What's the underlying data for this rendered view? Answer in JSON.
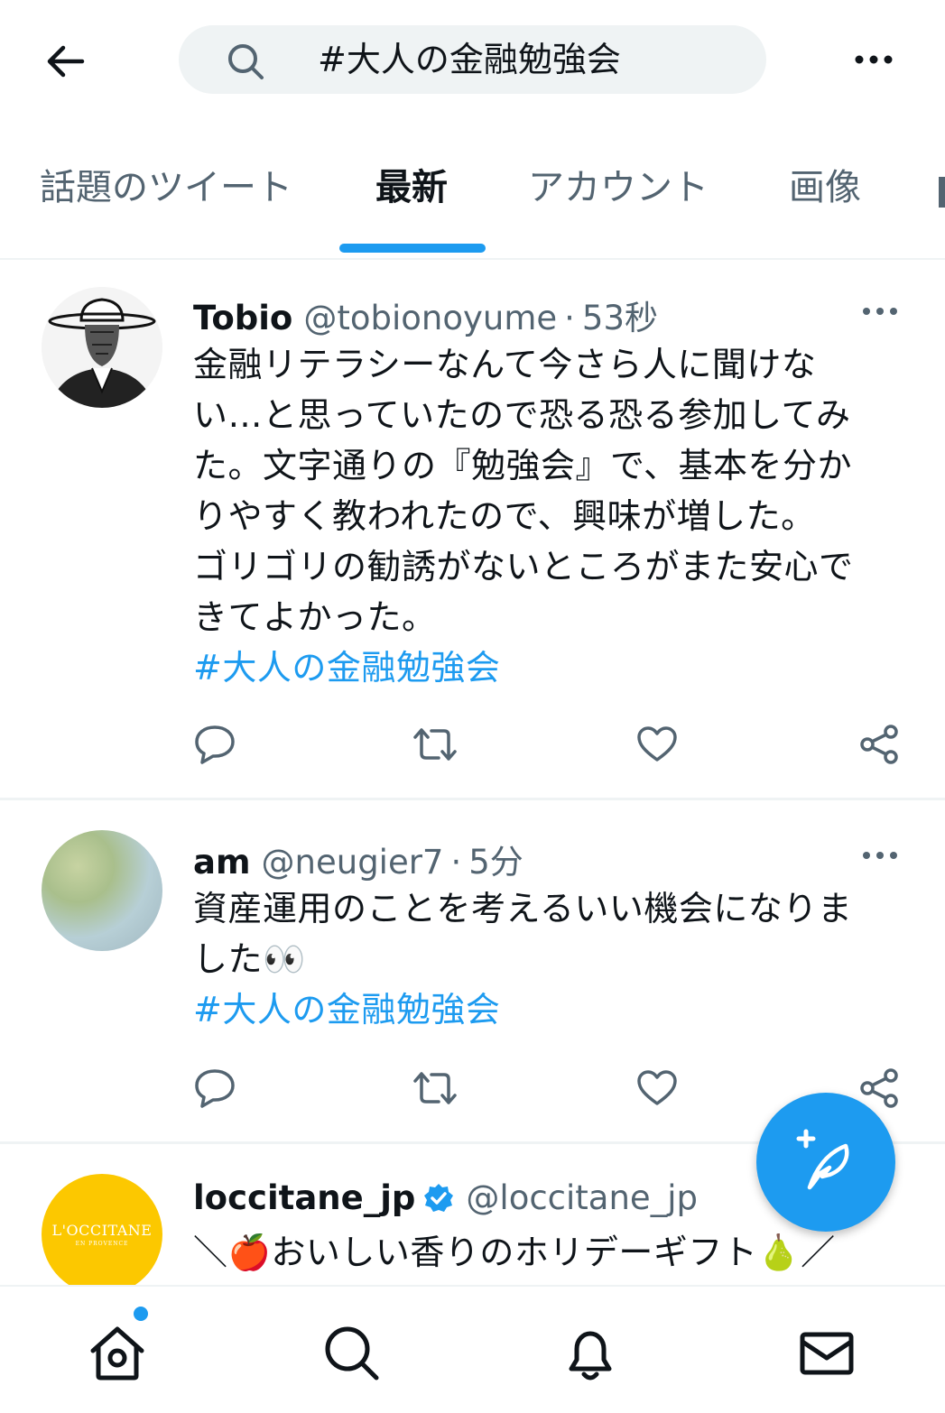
{
  "search": {
    "query": "#大人の金融勉強会"
  },
  "tabs": [
    {
      "label": "話題のツイート"
    },
    {
      "label": "最新",
      "active": true
    },
    {
      "label": "アカウント"
    },
    {
      "label": "画像"
    }
  ],
  "tweets": [
    {
      "name": "Tobio",
      "handle": "@tobionoyume",
      "sep": "·",
      "time": "53秒",
      "lines": [
        "金融リテラシーなんて今さら人に聞けな",
        "い…と思っていたので恐る恐る参加してみ",
        "た。文字通りの『勉強会』で、基本を分か",
        "りやすく教われたので、興味が増した。",
        "ゴリゴリの勧誘がないところがまた安心で",
        "きてよかった。"
      ],
      "hashtag": "#大人の金融勉強会"
    },
    {
      "name": "am",
      "handle": "@neugier7",
      "sep": "·",
      "time": "5分",
      "lines": [
        "資産運用のことを考えるいい機会になりま",
        "した👀"
      ],
      "hashtag": "#大人の金融勉強会"
    },
    {
      "name": "loccitane_jp",
      "handle": "@loccitane_jp",
      "verified": true,
      "lines": [
        "＼🍎おいしい香りのホリデーギフト🍐／"
      ],
      "avatar_text": "L'OCCITANE",
      "avatar_subtext": "EN PROVENCE"
    }
  ],
  "colors": {
    "accent": "#1d9bf0",
    "text": "#0f1419",
    "secondary": "#536471",
    "divider": "#eff3f4",
    "loccitane_yellow": "#fcc800"
  },
  "icons": {
    "back": "arrow-left-icon",
    "search": "search-icon",
    "more": "more-horizontal-icon",
    "reply": "reply-icon",
    "retweet": "retweet-icon",
    "like": "heart-icon",
    "share": "share-icon",
    "compose": "compose-feather-icon",
    "home": "home-icon",
    "explore": "search-icon",
    "notifications": "bell-icon",
    "messages": "mail-icon"
  }
}
